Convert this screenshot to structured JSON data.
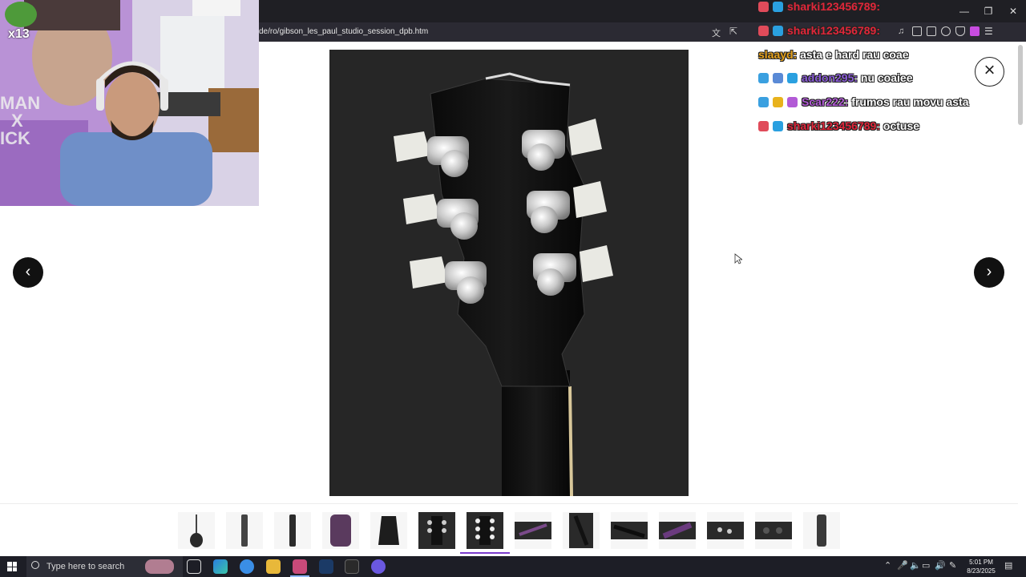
{
  "browser": {
    "url": "de/ro/gibson_les_paul_studio_session_dpb.htm"
  },
  "stream_overlay": {
    "emote_label": "x13",
    "shirt_text_left": "MAN",
    "shirt_text_left2": "X",
    "shirt_text_left3": "ICK"
  },
  "chat": {
    "messages": [
      {
        "user": "sharki123456789:",
        "text": "",
        "user_color": "#e0263a"
      },
      {
        "user": "sharki123456789:",
        "text": "",
        "user_color": "#e0263a"
      },
      {
        "user": "slaayd:",
        "text": "asta e hard rau coae",
        "user_color": "#e7a21c"
      },
      {
        "user": "addon295:",
        "text": "nu coaiee",
        "user_color": "#8a5cd6"
      },
      {
        "user": "Scar222:",
        "text": "frumos rau movu asta",
        "user_color": "#b25ad6"
      },
      {
        "user": "sharki123456789:",
        "text": "octuse",
        "user_color": "#e0263a"
      }
    ]
  },
  "gallery": {
    "prev_label": "‹",
    "next_label": "›",
    "close_label": "×",
    "image_subject": "guitar headstock back with six chrome tuners",
    "active_index": 6,
    "thumbnail_count": 14
  },
  "taskbar": {
    "search_placeholder": "Type here to search",
    "time": "5:01 PM",
    "date": "8/23/2025"
  },
  "colors": {
    "accent": "#7a3bcc",
    "chrome_bg": "#2b2a33",
    "taskbar_bg": "#1d1e26",
    "image_bg": "#272727"
  }
}
